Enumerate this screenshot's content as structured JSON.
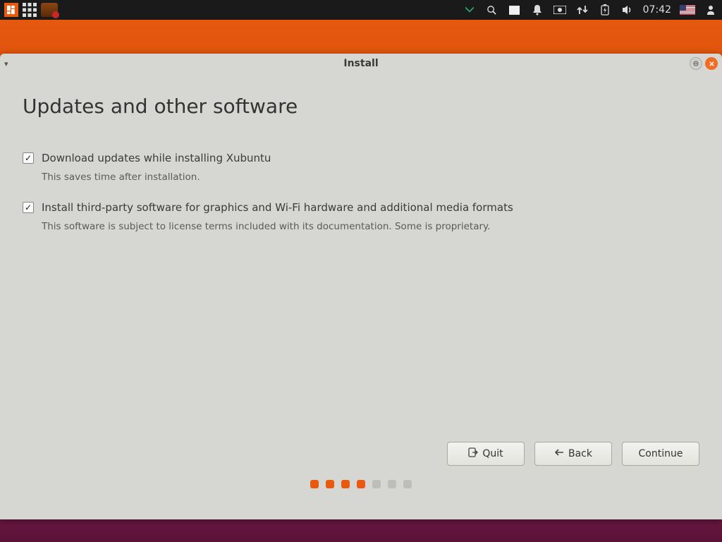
{
  "panel": {
    "clock": "07:42"
  },
  "window": {
    "title": "Install"
  },
  "page": {
    "heading": "Updates and other software"
  },
  "options": {
    "updates": {
      "label": "Download updates while installing Xubuntu",
      "desc": "This saves time after installation.",
      "checked": true
    },
    "thirdparty": {
      "label": "Install third-party software for graphics and Wi-Fi hardware and additional media formats",
      "desc": "This software is subject to license terms included with its documentation. Some is proprietary.",
      "checked": true
    }
  },
  "actions": {
    "quit": "Quit",
    "back": "Back",
    "continue": "Continue"
  },
  "progress": {
    "total": 7,
    "current": 4
  }
}
